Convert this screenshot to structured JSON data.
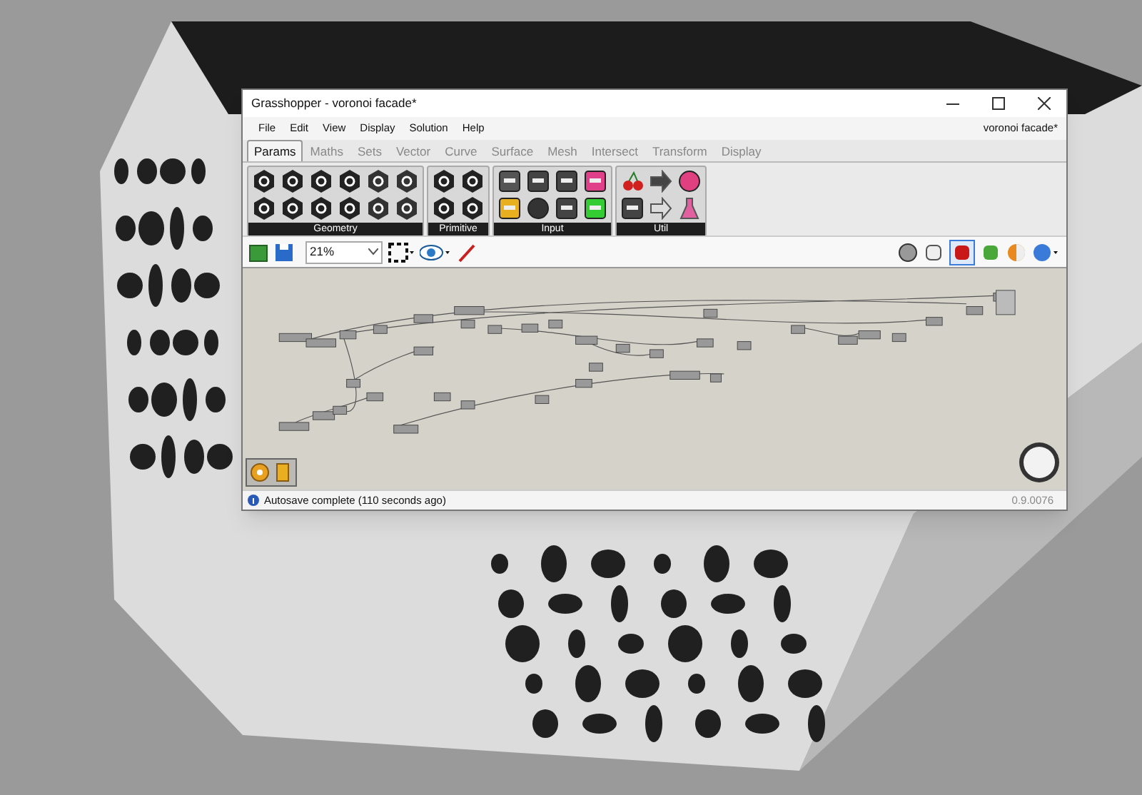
{
  "window": {
    "title": "Grasshopper - voronoi facade*"
  },
  "menu": {
    "items": [
      "File",
      "Edit",
      "View",
      "Display",
      "Solution",
      "Help"
    ],
    "document": "voronoi facade*"
  },
  "tabs": [
    {
      "label": "Params",
      "selected": true
    },
    {
      "label": "Maths",
      "selected": false
    },
    {
      "label": "Sets",
      "selected": false
    },
    {
      "label": "Vector",
      "selected": false
    },
    {
      "label": "Curve",
      "selected": false
    },
    {
      "label": "Surface",
      "selected": false
    },
    {
      "label": "Mesh",
      "selected": false
    },
    {
      "label": "Intersect",
      "selected": false
    },
    {
      "label": "Transform",
      "selected": false
    },
    {
      "label": "Display",
      "selected": false
    }
  ],
  "ribbon_groups": [
    {
      "name": "Geometry"
    },
    {
      "name": "Primitive"
    },
    {
      "name": "Input"
    },
    {
      "name": "Util"
    }
  ],
  "toolbar": {
    "zoom": "21%"
  },
  "status_bar": {
    "message": "Autosave complete (110 seconds ago)",
    "version": "0.9.0076"
  }
}
